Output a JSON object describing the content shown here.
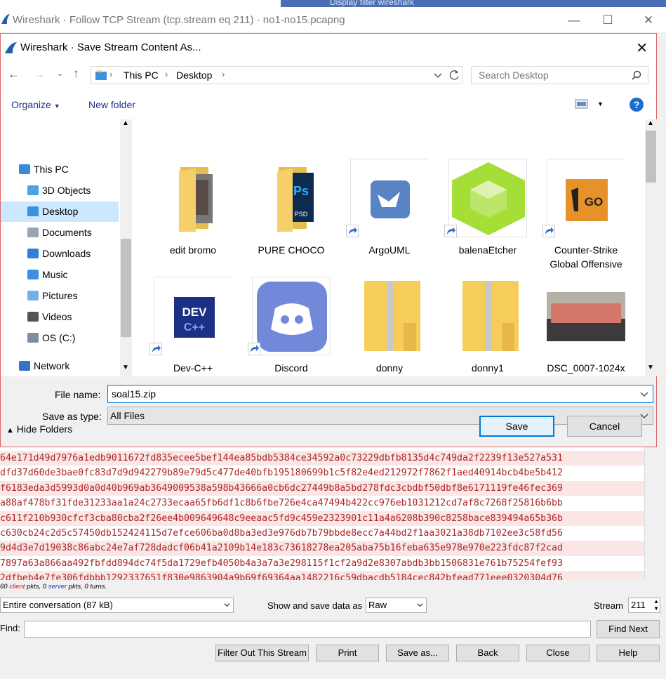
{
  "background": {
    "display_filter_text": "Display filter wireshark",
    "window_title": "Wireshark · Follow TCP Stream (tcp.stream eq 211) · no1-no15.pcapng",
    "hex_lines": [
      "64e171d49d7976a1edb9011672fd835ecee5bef144ea85bdb5384ce34592a0c73229dbfb8135d4c749da2f2239f13e527a531",
      "dfd37d60de3bae0fc83d7d9d942279b89e79d5c477de40bfb195180699b1c5f82e4ed212972f7862f1aed40914bcb4be5b412",
      "f6183eda3d5993d0a0d40b969ab3649009538a598b43666a0cb6dc27449b8a5bd278fdc3cbdbf50dbf8e6171119fe46fec369",
      "a88af478bf31fde31233aa1a24c2733ecaa65fb6df1c8b6fbe726e4ca47494b422cc976eb1031212cd7af8c7268f25816b6bb",
      "c611f210b930cfcf3cba80cba2f26ee4b009649648c9eeaac5fd9c459e2323901c11a4a6208b390c8258bace839494a65b36b",
      "c630cb24c2d5c57450db152424115d7efce606ba0d8ba3ed3e976db7b79bbde8ecc7a44bd2f1aa3021a38db7102ee3c58fd56",
      "9d4d3e7d19038c86abc24e7af728dadcf06b41a2109b14e183c73618278ea205aba75b16feba635e978e970e223fdc87f2cad",
      "7897a63a866aa492fbfdd894dc74f5da1729efb4050b4a3a7a3e298115f1cf2a9d2e8307abdb3bb1506831e761b75254fef93",
      "2dfbeb4e7fe306fdbbb1292337651f830e9863904a9b69f69364aa1482216c59dbacdb5184cec842bfead771eee0320304d76"
    ],
    "stats": {
      "client_count": "60",
      "client_word": "client",
      "mid": "pkts, 0",
      "server_word": "server",
      "tail": "pkts, 0 turns."
    },
    "conversation_select": "Entire conversation (87 kB)",
    "show_save_label": "Show and save data as",
    "show_save_value": "Raw",
    "stream_label": "Stream",
    "stream_value": "211",
    "find_label": "Find:",
    "find_next": "Find Next",
    "buttons": [
      "Filter Out This Stream",
      "Print",
      "Save as...",
      "Back",
      "Close",
      "Help"
    ]
  },
  "dialog": {
    "title": "Wireshark · Save Stream Content As...",
    "breadcrumb": [
      "This PC",
      "Desktop"
    ],
    "search_placeholder": "Search Desktop",
    "organize_label": "Organize",
    "new_folder_label": "New folder",
    "nav_items": [
      {
        "label": "This PC",
        "icon": "computer-icon",
        "indent": 1
      },
      {
        "label": "3D Objects",
        "icon": "3d-objects-icon",
        "indent": 2
      },
      {
        "label": "Desktop",
        "icon": "desktop-folder-icon",
        "indent": 2,
        "selected": true
      },
      {
        "label": "Documents",
        "icon": "documents-icon",
        "indent": 2
      },
      {
        "label": "Downloads",
        "icon": "downloads-icon",
        "indent": 2
      },
      {
        "label": "Music",
        "icon": "music-icon",
        "indent": 2
      },
      {
        "label": "Pictures",
        "icon": "pictures-icon",
        "indent": 2
      },
      {
        "label": "Videos",
        "icon": "videos-icon",
        "indent": 2
      },
      {
        "label": "OS (C:)",
        "icon": "drive-icon",
        "indent": 2
      },
      {
        "label": "Network",
        "icon": "network-icon",
        "indent": 1
      }
    ],
    "files": [
      {
        "name": "edit bromo",
        "kind": "folder-photos"
      },
      {
        "name": "PURE CHOCO",
        "kind": "folder-ps"
      },
      {
        "name": "ArgoUML",
        "kind": "shortcut-argouml"
      },
      {
        "name": "balenaEtcher",
        "kind": "shortcut-etcher"
      },
      {
        "name": "Counter-Strike Global Offensive",
        "kind": "shortcut-csgo"
      },
      {
        "name": "Dev-C++",
        "kind": "shortcut-devcpp"
      },
      {
        "name": "Discord",
        "kind": "shortcut-discord"
      },
      {
        "name": "donny",
        "kind": "zip-folder"
      },
      {
        "name": "donny1",
        "kind": "zip-folder"
      },
      {
        "name": "DSC_0007-1024x",
        "kind": "photo"
      }
    ],
    "file_name_label": "File name:",
    "file_name_value": "soal15.zip",
    "save_type_label": "Save as type:",
    "save_type_value": "All Files",
    "hide_folders_label": "Hide Folders",
    "save_button": "Save",
    "cancel_button": "Cancel"
  },
  "colors": {
    "accent": "#0078d7",
    "hex_text": "#ad2424",
    "selection": "#cce8ff",
    "dialog_border": "#e06666"
  }
}
